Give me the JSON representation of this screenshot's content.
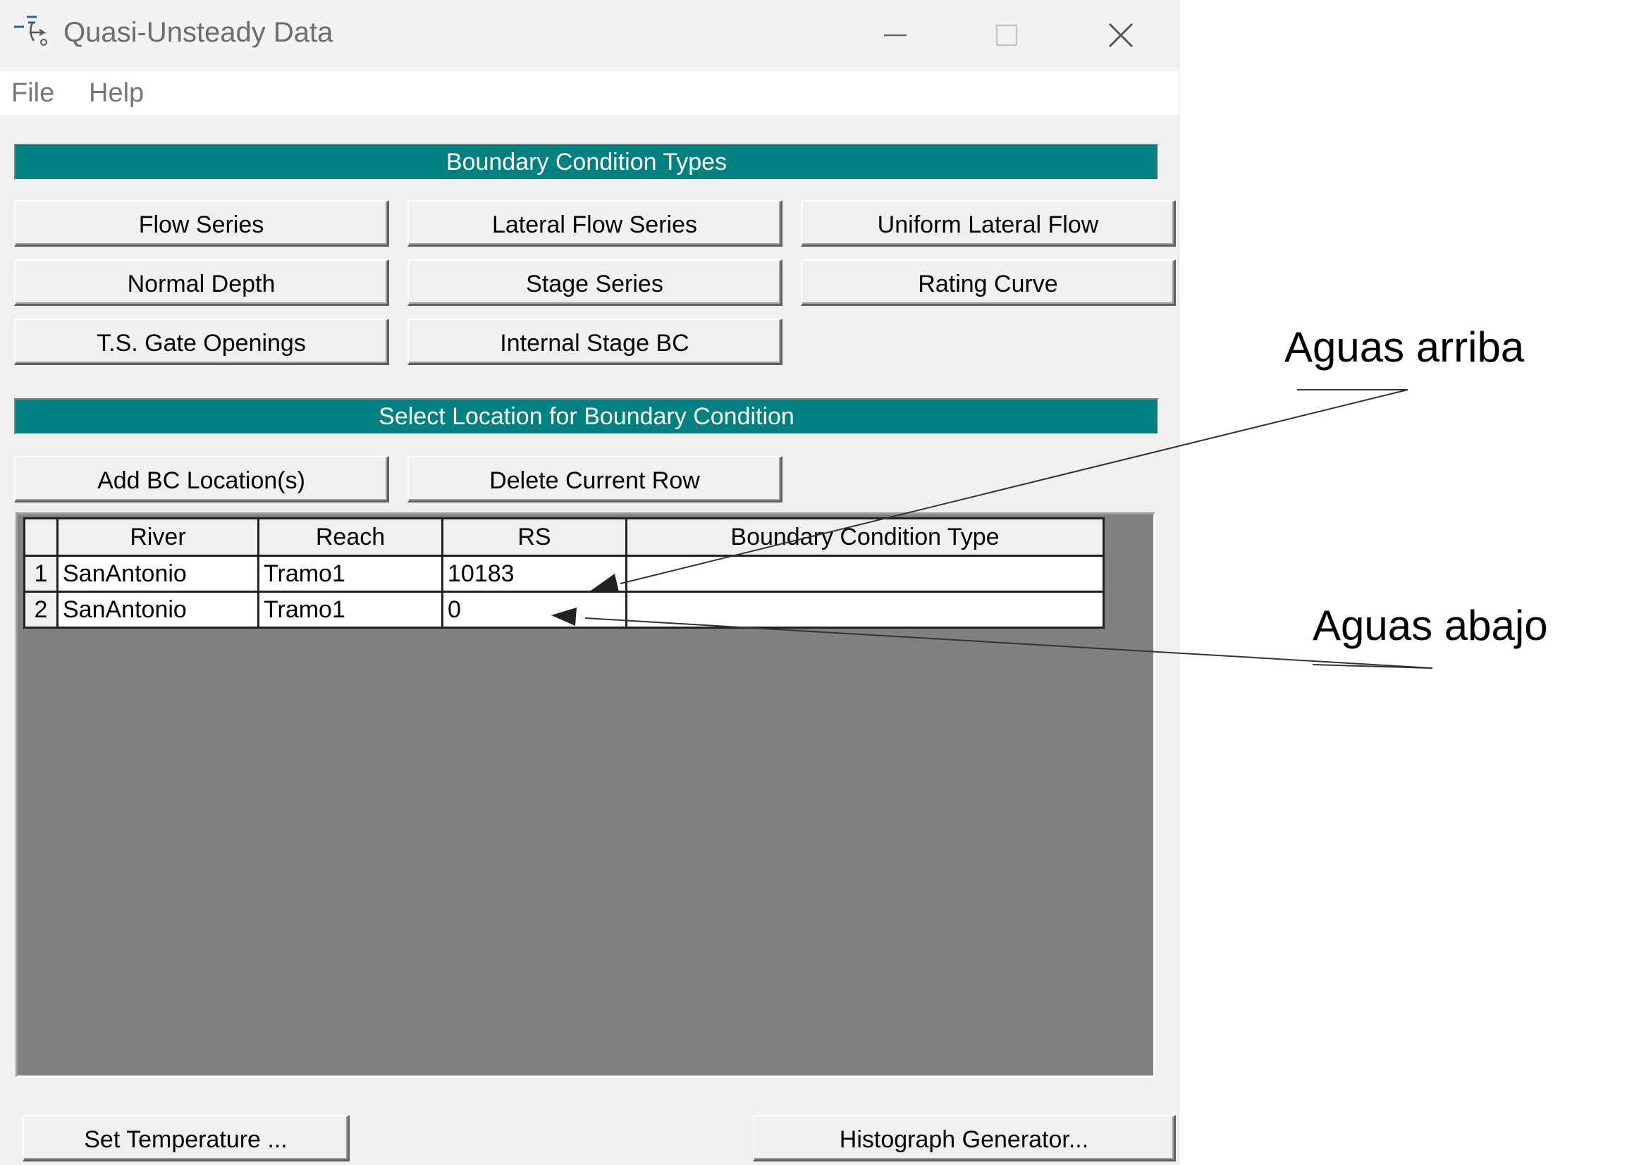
{
  "window": {
    "title": "Quasi-Unsteady Data",
    "icon": "hec-ras-quasi-unsteady-icon",
    "controls": [
      "minimize-icon",
      "maximize-icon",
      "close-icon"
    ]
  },
  "menu": {
    "file": "File",
    "help": "Help"
  },
  "bc_types": {
    "header": "Boundary Condition Types",
    "buttons": {
      "flow_series": "Flow Series",
      "lateral_flow_series": "Lateral Flow Series",
      "uniform_lateral_flow": "Uniform Lateral Flow",
      "normal_depth": "Normal Depth",
      "stage_series": "Stage Series",
      "rating_curve": "Rating Curve",
      "ts_gate_openings": "T.S. Gate Openings",
      "internal_stage_bc": "Internal Stage BC"
    }
  },
  "location": {
    "header": "Select Location for Boundary Condition",
    "add_button": "Add BC Location(s)",
    "delete_button": "Delete Current Row"
  },
  "table": {
    "columns": [
      "River",
      "Reach",
      "RS",
      "Boundary Condition Type"
    ],
    "rows": [
      {
        "num": "1",
        "river": "SanAntonio",
        "reach": "Tramo1",
        "rs": "10183",
        "bc_type": ""
      },
      {
        "num": "2",
        "river": "SanAntonio",
        "reach": "Tramo1",
        "rs": "0",
        "bc_type": ""
      }
    ]
  },
  "footer": {
    "set_temperature": "Set Temperature ...",
    "histograph_generator": "Histograph Generator..."
  },
  "annotations": {
    "upstream": "Aguas arriba",
    "downstream": "Aguas abajo"
  },
  "colors": {
    "section_bar": "#008080",
    "window_bg": "#f0f0f0",
    "grid_bg": "#808080"
  }
}
